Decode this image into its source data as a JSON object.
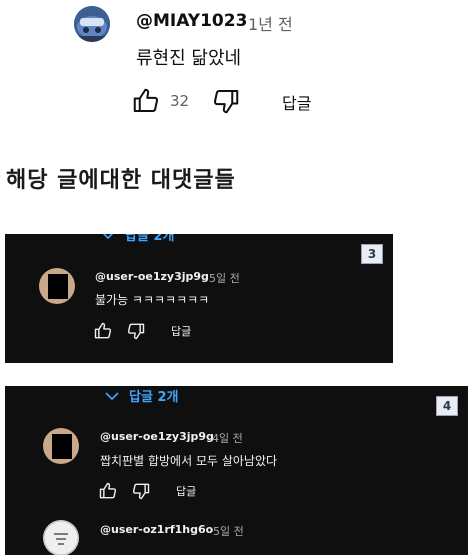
{
  "top_comment": {
    "author": "@MIAY1023",
    "time": "1년 전",
    "text": "류현진 닮았네",
    "like_count": "32",
    "reply_label": "답글"
  },
  "section_title": "해당 글에대한 대댓글들",
  "panels": [
    {
      "badge": "3",
      "replies_toggle": "답글 2개",
      "comment": {
        "author": "@user-oe1zy3jp9g",
        "time": "5일 전",
        "text": "불가능 ㅋㅋㅋㅋㅋㅋㅋ",
        "reply_label": "답글"
      }
    },
    {
      "badge": "4",
      "replies_toggle": "답글 2개",
      "comments": [
        {
          "author": "@user-oe1zy3jp9g",
          "time": "4일 전",
          "text": "짭치판별 합방에서 모두 살아남았다",
          "reply_label": "답글"
        },
        {
          "author": "@user-oz1rf1hg6o",
          "time": "5일 전"
        }
      ]
    }
  ],
  "colors": {
    "dark_bg": "#0f0f0f",
    "link_blue": "#3ea6ff",
    "secondary_text": "#606060"
  }
}
